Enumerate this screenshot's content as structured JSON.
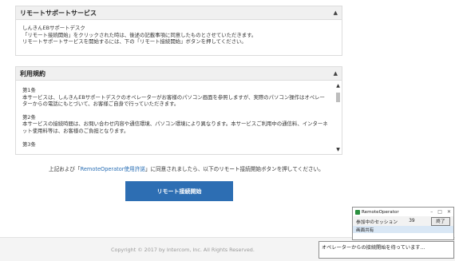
{
  "remote_panel": {
    "title": "リモートサポートサービス",
    "lines": [
      "しんきんEBサポートデスク",
      "「リモート接続開始」をクリックされた時は、後述の記載事項に同意したものとさせていただきます。",
      "リモートサポートサービスを開始するには、下の「リモート接続開始」ボタンを押してください。"
    ]
  },
  "terms_panel": {
    "title": "利用規約",
    "articles": [
      {
        "heading": "第1条",
        "text": "本サービスは、しんきんEBサポートデスクのオペレーターがお客様のパソコン画面を参照しますが、実際のパソコン操作はオペレーターからの電話にもとづいて、お客様ご自身で行っていただきます。"
      },
      {
        "heading": "第2条",
        "text": "本サービスの接続時間は、お問い合わせ内容や通信環境、パソコン環境により異なります。本サービスご利用中の通信料、インターネット使用料等は、お客様のご負担となります。"
      },
      {
        "heading": "第3条",
        "text": ""
      }
    ]
  },
  "agreement": {
    "prefix": "上記および「",
    "link": "RemoteOperator使用許諾",
    "suffix": "」に同意されましたら、以下のリモート接続開始ボタンを押してください。"
  },
  "start_button": "リモート接続開始",
  "footer": {
    "copyright": "Copyright © 2017 by Intercom, Inc. All Rights Reserved."
  },
  "remote_operator": {
    "title": "RemoteOperator",
    "session_label": "参加中のセッション",
    "session_count": "39",
    "end_button": "終了",
    "tab": "画面共有",
    "status": "オペレーターからの接続開始を待っています..."
  },
  "icons": {
    "collapse": "chevron-up-icon",
    "scroll_up": "scroll-up-icon",
    "scroll_down": "scroll-down-icon",
    "app": "remote-operator-app-icon"
  },
  "colors": {
    "accent": "#2d6eb3",
    "link": "#2a6fb5",
    "panel_header": "#f0f0f0",
    "footer": "#f4f4f4"
  }
}
